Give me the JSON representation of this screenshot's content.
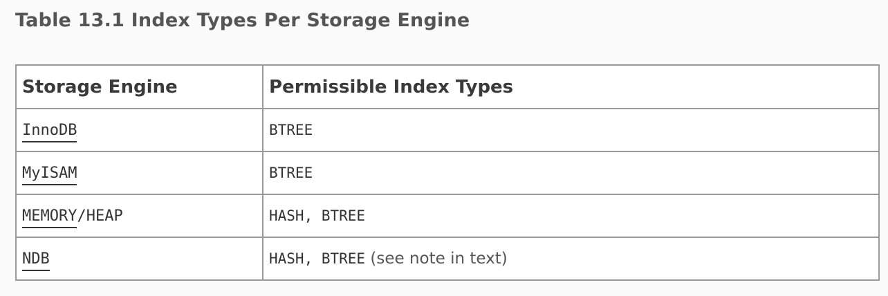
{
  "caption": "Table 13.1 Index Types Per Storage Engine",
  "table": {
    "headers": [
      "Storage Engine",
      "Permissible Index Types"
    ],
    "rows": [
      {
        "engine_link": "InnoDB",
        "engine_suffix": "",
        "types": "BTREE",
        "note": ""
      },
      {
        "engine_link": "MyISAM",
        "engine_suffix": "",
        "types": "BTREE",
        "note": ""
      },
      {
        "engine_link": "MEMORY",
        "engine_suffix": "/HEAP",
        "types": "HASH, BTREE",
        "note": ""
      },
      {
        "engine_link": "NDB",
        "engine_suffix": "",
        "types": "HASH, BTREE",
        "note": " (see note in text)"
      }
    ]
  }
}
